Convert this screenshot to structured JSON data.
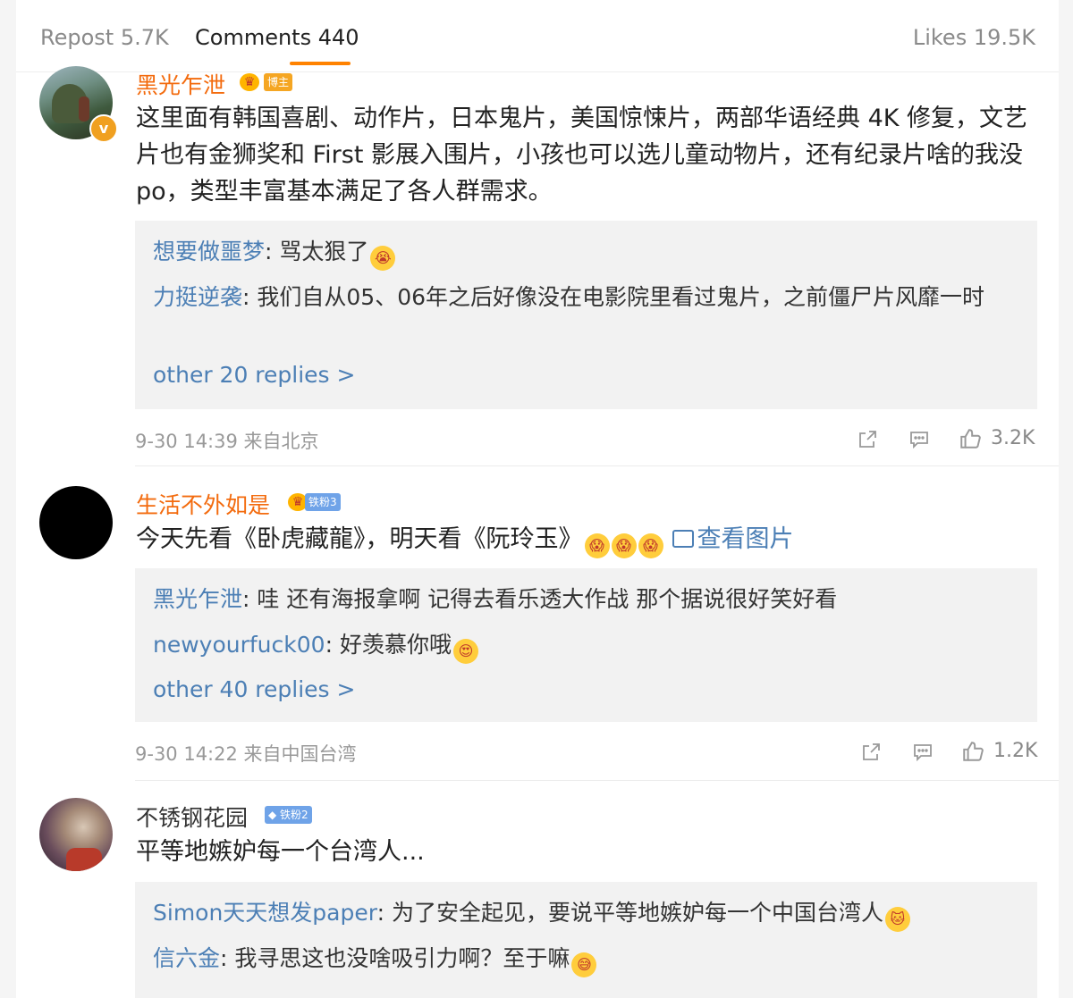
{
  "tabs": {
    "repost": "Repost 5.7K",
    "comments": "Comments 440",
    "likes": "Likes 19.5K"
  },
  "colors": {
    "accent": "#ff8200",
    "link": "#4c7fb5",
    "name_orange": "#f36b0e"
  },
  "comments": [
    {
      "user": "黑光乍泄",
      "badge": "博主",
      "verified_badge": "v",
      "text": "这里面有韩国喜剧、动作片，日本鬼片，美国惊悚片，两部华语经典 4K 修复，文艺片也有金狮奖和 First 影展入围片，小孩也可以选儿童动物片，还有纪录片啥的我没 po，类型丰富基本满足了各人群需求。",
      "replies": [
        {
          "user": "想要做噩梦",
          "sep": ": ",
          "text": "骂太狠了",
          "emoji": "crying-face"
        },
        {
          "user": "力挺逆袭",
          "sep": ": ",
          "text": "我们自从05、06年之后好像没在电影院里看过鬼片，之前僵尸片风靡一时"
        }
      ],
      "more_replies": "other 20 replies >",
      "time": "9-30 14:39 来自北京",
      "likes": "3.2K"
    },
    {
      "user": "生活不外如是",
      "badge": "铁粉3",
      "text": "今天先看《卧虎藏龍》，明天看《阮玲玉》",
      "emojis": [
        "shocked-face",
        "shocked-face",
        "shocked-face"
      ],
      "pic_link": "查看图片",
      "replies": [
        {
          "user": "黑光乍泄",
          "sep": ": ",
          "text": "哇 还有海报拿啊 记得去看乐透大作战 那个据说很好笑好看"
        },
        {
          "user": "newyourfuck00",
          "sep": ": ",
          "text": "好羡慕你哦",
          "emoji": "heart-eyes-face"
        }
      ],
      "more_replies": "other 40 replies >",
      "time": "9-30 14:22 来自中国台湾",
      "likes": "1.2K"
    },
    {
      "user": "不锈钢花园",
      "badge": "铁粉2",
      "text": "平等地嫉妒每一个台湾人...",
      "replies": [
        {
          "user": "Simon天天想发paper",
          "sep": ": ",
          "text": "为了安全起见，要说平等地嫉妒每一个中国台湾人",
          "emoji": "cat-face"
        },
        {
          "user": "信六金",
          "sep": ": ",
          "text": "我寻思这也没啥吸引力啊？至于嘛",
          "emoji": "sweat-smile-face"
        }
      ]
    }
  ]
}
